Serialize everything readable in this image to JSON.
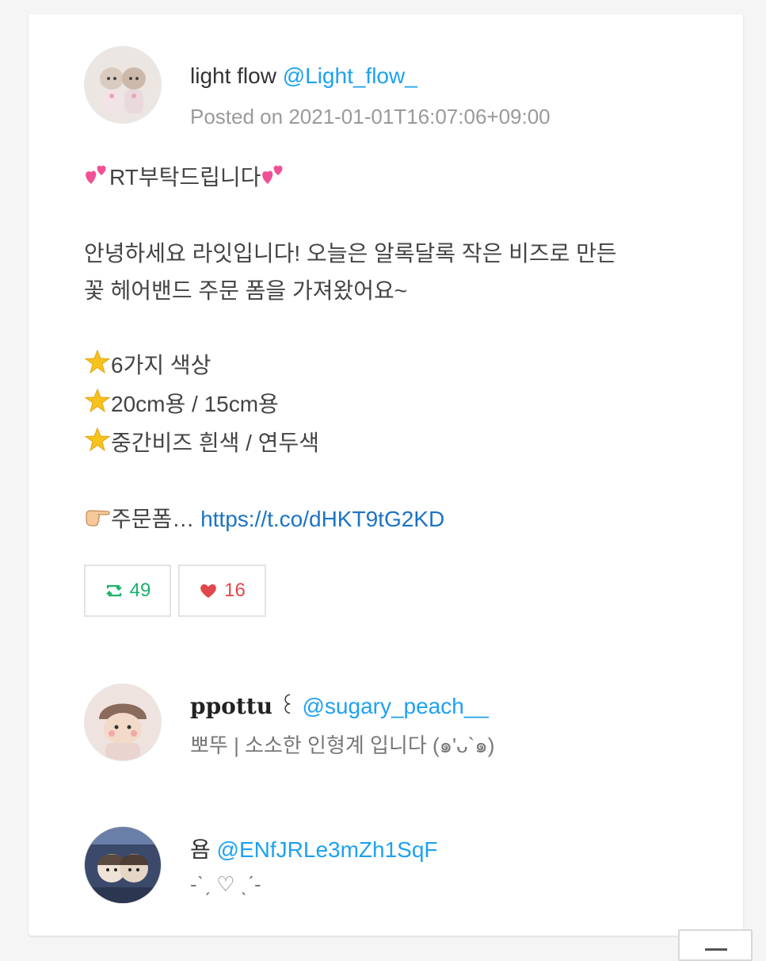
{
  "tweet": {
    "author_name": "light flow",
    "author_handle": "@Light_flow_",
    "posted": "Posted on 2021-01-01T16:07:06+09:00",
    "lines": {
      "title": "RT부탁드립니다",
      "intro1": "안녕하세요 라잇입니다! 오늘은 알록달록 작은 비즈로 만든",
      "intro2": "꽃 헤어밴드 주문 폼을 가져왔어요~",
      "item1": "6가지 색상",
      "item2": "20cm용 / 15cm용",
      "item3": "중간비즈 흰색 / 연두색",
      "form_label": "주문폼… ",
      "form_link": "https://t.co/dHKT9tG2KD"
    },
    "retweets": "49",
    "likes": "16"
  },
  "users": [
    {
      "name": "ppottu",
      "name_suffix": " ꒰ ",
      "handle": "@sugary_peach__",
      "bio": "뽀뚜 | 소소한 인형계 입니다 (๑'ᴗ`๑)"
    },
    {
      "name": "욤",
      "name_suffix": " ",
      "handle": "@ENfJRLe3mZh1SqF",
      "bio": "-ˋˏ ♡ ˎˊ-"
    }
  ],
  "colors": {
    "handle": "#1da1f2",
    "link": "#1b73c4",
    "retweet": "#19b26b",
    "like": "#e0474c"
  },
  "icons": [
    "two-hearts-icon",
    "star-icon",
    "pointing-hand-icon",
    "retweet-icon",
    "heart-icon",
    "scroll-top-icon"
  ]
}
